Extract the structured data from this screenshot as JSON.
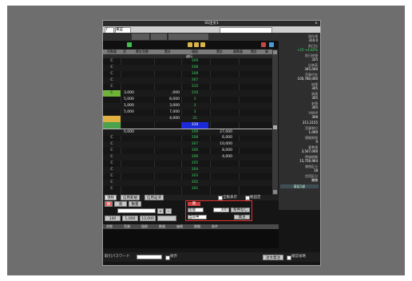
{
  "window": {
    "title": "SS注文1",
    "close_glyph": "×"
  },
  "toolbar": {
    "code_value": "7",
    "market_value": "東証"
  },
  "board": {
    "column_headers": [
      "売数量",
      "売",
      "累計売数",
      "累計",
      "値段",
      "累計",
      "買数量",
      "累計",
      "買"
    ],
    "last_label": "成行",
    "rows": [
      {
        "s": "C",
        "t": "",
        "b": "",
        "p": "309",
        "a": ""
      },
      {
        "s": "C",
        "t": "",
        "b": "",
        "p": "308",
        "a": ""
      },
      {
        "s": "C",
        "t": "",
        "b": "",
        "p": "308",
        "a": ""
      },
      {
        "s": "C",
        "t": "",
        "b": "",
        "p": "307",
        "a": ""
      },
      {
        "s": "C",
        "t": "",
        "b": "",
        "p": "310",
        "a": ""
      },
      {
        "s": "C",
        "t": "3,000",
        "b": ",000",
        "p": "310",
        "a": ""
      },
      {
        "s": "",
        "t": "5,000",
        "b": "8,000",
        "p": "3",
        "a": ""
      },
      {
        "s": "",
        "t": "1,000",
        "b": "3,000",
        "p": "3",
        "a": ""
      },
      {
        "s": "",
        "t": "5,000",
        "b": "7,000",
        "p": "3",
        "a": ""
      },
      {
        "s": "",
        "t": "",
        "b": "4,000",
        "p": "31",
        "a": ""
      },
      {
        "s": "",
        "t": "",
        "b": "",
        "p": "310",
        "a": ""
      },
      {
        "s": "",
        "t": "0,000",
        "b": "",
        "p": "309",
        "a": "27,000"
      },
      {
        "s": "C",
        "t": "",
        "b": "",
        "p": "308",
        "a": "6,000"
      },
      {
        "s": "C",
        "t": "",
        "b": "",
        "p": "307",
        "a": "10,000"
      },
      {
        "s": "C",
        "t": "",
        "b": "",
        "p": "300",
        "a": "8,000"
      },
      {
        "s": "C",
        "t": "",
        "b": "",
        "p": "306",
        "a": "4,000"
      },
      {
        "s": "C",
        "t": "",
        "b": "",
        "p": "305",
        "a": ""
      },
      {
        "s": "C",
        "t": "",
        "b": "",
        "p": "304",
        "a": ""
      },
      {
        "s": "C",
        "t": "",
        "b": "",
        "p": "303",
        "a": ""
      },
      {
        "s": "C",
        "t": "",
        "b": "",
        "p": "302",
        "a": ""
      },
      {
        "s": "C",
        "t": "",
        "b": "",
        "p": "301",
        "a": ""
      }
    ]
  },
  "side_panel": {
    "items": [
      {
        "label": "現在値",
        "value": "310.0"
      },
      {
        "label": "前日比",
        "value": "+15 +4.82%"
      },
      {
        "label": "前日終値",
        "value": "325"
      },
      {
        "label": "出来高",
        "value": "345,000"
      },
      {
        "label": "売買代金",
        "value": "100,780,000"
      },
      {
        "label": "始値",
        "value": "305"
      },
      {
        "label": "高値",
        "value": "305"
      },
      {
        "label": "安値",
        "value": "305"
      },
      {
        "label": "VWAP",
        "value": "308"
      },
      {
        "label": "",
        "value": "311.2155"
      },
      {
        "label": "売買単位",
        "value": "1,000"
      },
      {
        "label": "値幅制限",
        "value": "0"
      },
      {
        "label": "基準値",
        "value": "3,547,000"
      },
      {
        "label": "時価総額",
        "value": "15,756,964"
      },
      {
        "label": "貸借区分",
        "value": "18"
      },
      {
        "label": "信用区分",
        "value": "貸借"
      }
    ],
    "footer_label": "東証1部"
  },
  "tabs": {
    "items": [
      "現物",
      "信用新規",
      "信用返済"
    ],
    "checkbox1_label": "全板表示",
    "checkbox2_label": "板固定"
  },
  "order": {
    "buy_label": "買",
    "sell_label": "売",
    "qty_label": "数量",
    "price_type_label": "指値",
    "price_value": "300",
    "condition_label": "条件なし",
    "expiry_label": "当日中",
    "confirm_label": "発注",
    "qty_buttons": [
      "100",
      "1,000",
      "10,000"
    ]
  },
  "order_list": {
    "headers": [
      "状態",
      "売買",
      "銘柄",
      "数量",
      "価格",
      "期間",
      "条件"
    ]
  },
  "bottom": {
    "password_label": "取引パスワード",
    "save_label": "保存",
    "order_button": "注文発注",
    "confirm_label": "確認省略"
  }
}
